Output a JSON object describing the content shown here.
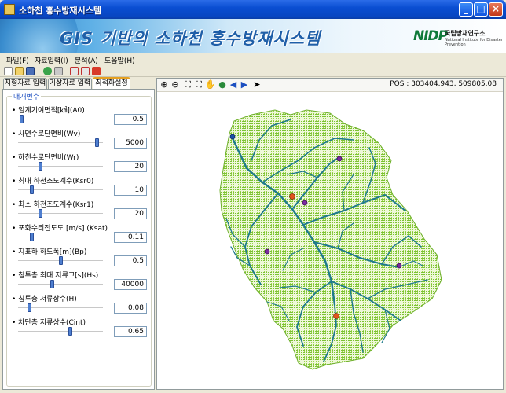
{
  "window": {
    "title": "소하천 홍수방재시스템"
  },
  "banner": {
    "title": "GIS 기반의 소하천 홍수방재시스템",
    "logo_mark": "NIDP",
    "logo_org_ko": "국립방재연구소",
    "logo_org_en": "National Institute for Disaster Prevention"
  },
  "menu": [
    {
      "label": "파일(F)"
    },
    {
      "label": "자료입력(I)"
    },
    {
      "label": "분석(A)"
    },
    {
      "label": "도움말(H)"
    }
  ],
  "toolbar_icons": [
    "new-icon",
    "open-icon",
    "save-icon",
    "globe-icon",
    "layers-icon",
    "chart-icon",
    "print-icon",
    "delete-icon"
  ],
  "tabs": [
    {
      "label": "지형자료 입력",
      "active": false
    },
    {
      "label": "기상자료 입력",
      "active": false
    },
    {
      "label": "최적화설정",
      "active": true
    }
  ],
  "params_group": {
    "legend": "매개변수"
  },
  "params": [
    {
      "label": "임계기여면적[㎢](A0)",
      "value": "0.5",
      "level": 0.02
    },
    {
      "label": "사면수로단면비(Wv)",
      "value": "5000",
      "level": 0.95
    },
    {
      "label": "하천수로단면비(Wr)",
      "value": "20",
      "level": 0.25
    },
    {
      "label": "최대 하천조도계수(Ksr0)",
      "value": "10",
      "level": 0.15
    },
    {
      "label": "최소 하천조도계수(Ksr1)",
      "value": "20",
      "level": 0.25
    },
    {
      "label": "포화수리전도도 [m/s] (Ksat)",
      "value": "0.11",
      "level": 0.15
    },
    {
      "label": "지표하 하도폭[m](Bp)",
      "value": "0.5",
      "level": 0.5
    },
    {
      "label": "침투층 최대 저류고[s](Hs)",
      "value": "40000",
      "level": 0.4
    },
    {
      "label": "침투층 저류상수(H)",
      "value": "0.08",
      "level": 0.12
    },
    {
      "label": "차단층 저류상수(Cint)",
      "value": "0.65",
      "level": 0.62
    }
  ],
  "map_tools": [
    "zoom-in-icon",
    "zoom-out-icon",
    "full-extent-icon",
    "fit-icon",
    "pan-icon",
    "globe-icon",
    "back-icon",
    "forward-icon",
    "select-icon"
  ],
  "map": {
    "position_readout": "POS : 303404.943, 509805.08"
  },
  "colors": {
    "watershed": "#8cc63f",
    "stream": "#1f7a8c",
    "outlet": "#e0541c",
    "gauge": "#7b2aa0",
    "station": "#1c4fa8"
  }
}
